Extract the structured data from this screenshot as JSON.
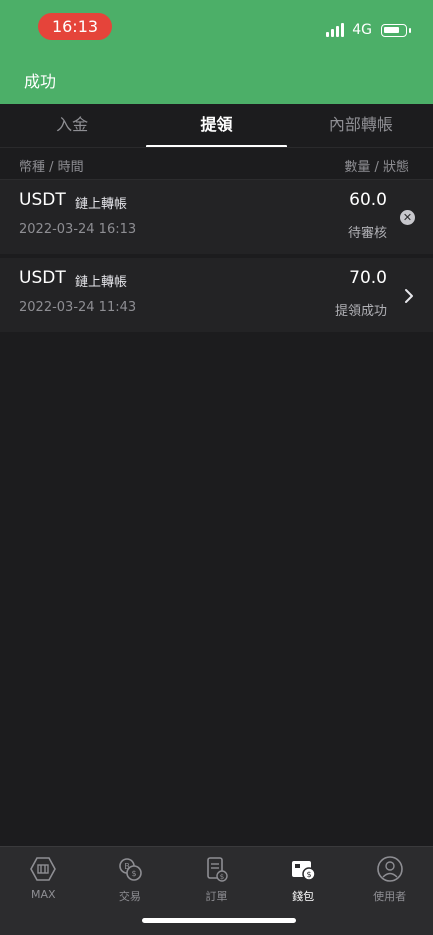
{
  "status_bar": {
    "time": "16:13",
    "network": "4G"
  },
  "header": {
    "title": "成功"
  },
  "tabs": [
    {
      "label": "入金",
      "active": false
    },
    {
      "label": "提領",
      "active": true
    },
    {
      "label": "內部轉帳",
      "active": false
    }
  ],
  "columns": {
    "left": "幣種 / 時間",
    "right": "數量 / 狀態"
  },
  "records": [
    {
      "coin": "USDT",
      "type": "鏈上轉帳",
      "date": "2022-03-24 16:13",
      "amount": "60.0",
      "status": "待審核",
      "action_icon": "cancel-icon"
    },
    {
      "coin": "USDT",
      "type": "鏈上轉帳",
      "date": "2022-03-24 11:43",
      "amount": "70.0",
      "status": "提領成功",
      "action_icon": "chevron-right-icon"
    }
  ],
  "bottom_nav": [
    {
      "label": "MAX",
      "icon": "max-logo-icon",
      "active": false
    },
    {
      "label": "交易",
      "icon": "exchange-icon",
      "active": false
    },
    {
      "label": "訂單",
      "icon": "orders-icon",
      "active": false
    },
    {
      "label": "錢包",
      "icon": "wallet-icon",
      "active": true
    },
    {
      "label": "使用者",
      "icon": "user-icon",
      "active": false
    }
  ],
  "colors": {
    "header_bg": "#4caf68",
    "time_pill": "#e5443a",
    "background": "#1c1c1e",
    "row_bg": "#232325"
  }
}
